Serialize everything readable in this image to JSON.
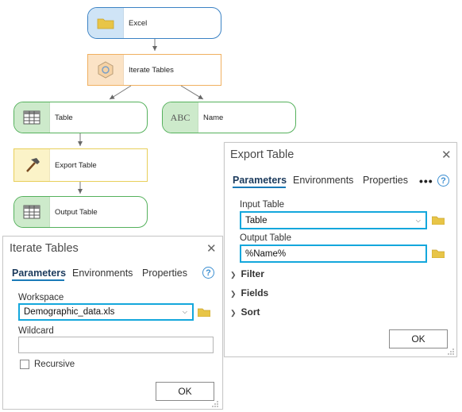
{
  "model": {
    "nodes": {
      "excel": {
        "label": "Excel",
        "icon": "folder-icon"
      },
      "iterate_tables": {
        "label": "Iterate Tables",
        "icon": "iterate-tool-icon"
      },
      "table": {
        "label": "Table",
        "icon": "table-icon"
      },
      "name": {
        "label": "Name",
        "icon": "abc-text-icon",
        "icon_text": "ABC"
      },
      "export_table": {
        "label": "Export Table",
        "icon": "hammer-tool-icon"
      },
      "output_table": {
        "label": "Output Table",
        "icon": "table-icon"
      }
    }
  },
  "iterate_dialog": {
    "title": "Iterate Tables",
    "close": "✕",
    "tabs": [
      "Parameters",
      "Environments",
      "Properties"
    ],
    "help": "?",
    "workspace_label": "Workspace",
    "workspace_value": "Demographic_data.xls",
    "wildcard_label": "Wildcard",
    "wildcard_value": "",
    "recursive_label": "Recursive",
    "ok_label": "OK"
  },
  "export_dialog": {
    "title": "Export Table",
    "close": "✕",
    "tabs": [
      "Parameters",
      "Environments",
      "Properties"
    ],
    "more": "•••",
    "help": "?",
    "input_table_label": "Input Table",
    "input_table_value": "Table",
    "output_table_label": "Output Table",
    "output_table_value": "%Name%",
    "sections": [
      "Filter",
      "Fields",
      "Sort"
    ],
    "ok_label": "OK"
  },
  "colors": {
    "highlight": "#14a7dc",
    "data_node": "#3b82c4",
    "tool_node": "#f0b060",
    "output_node": "#55b15c",
    "export_node": "#e8cf5a"
  }
}
